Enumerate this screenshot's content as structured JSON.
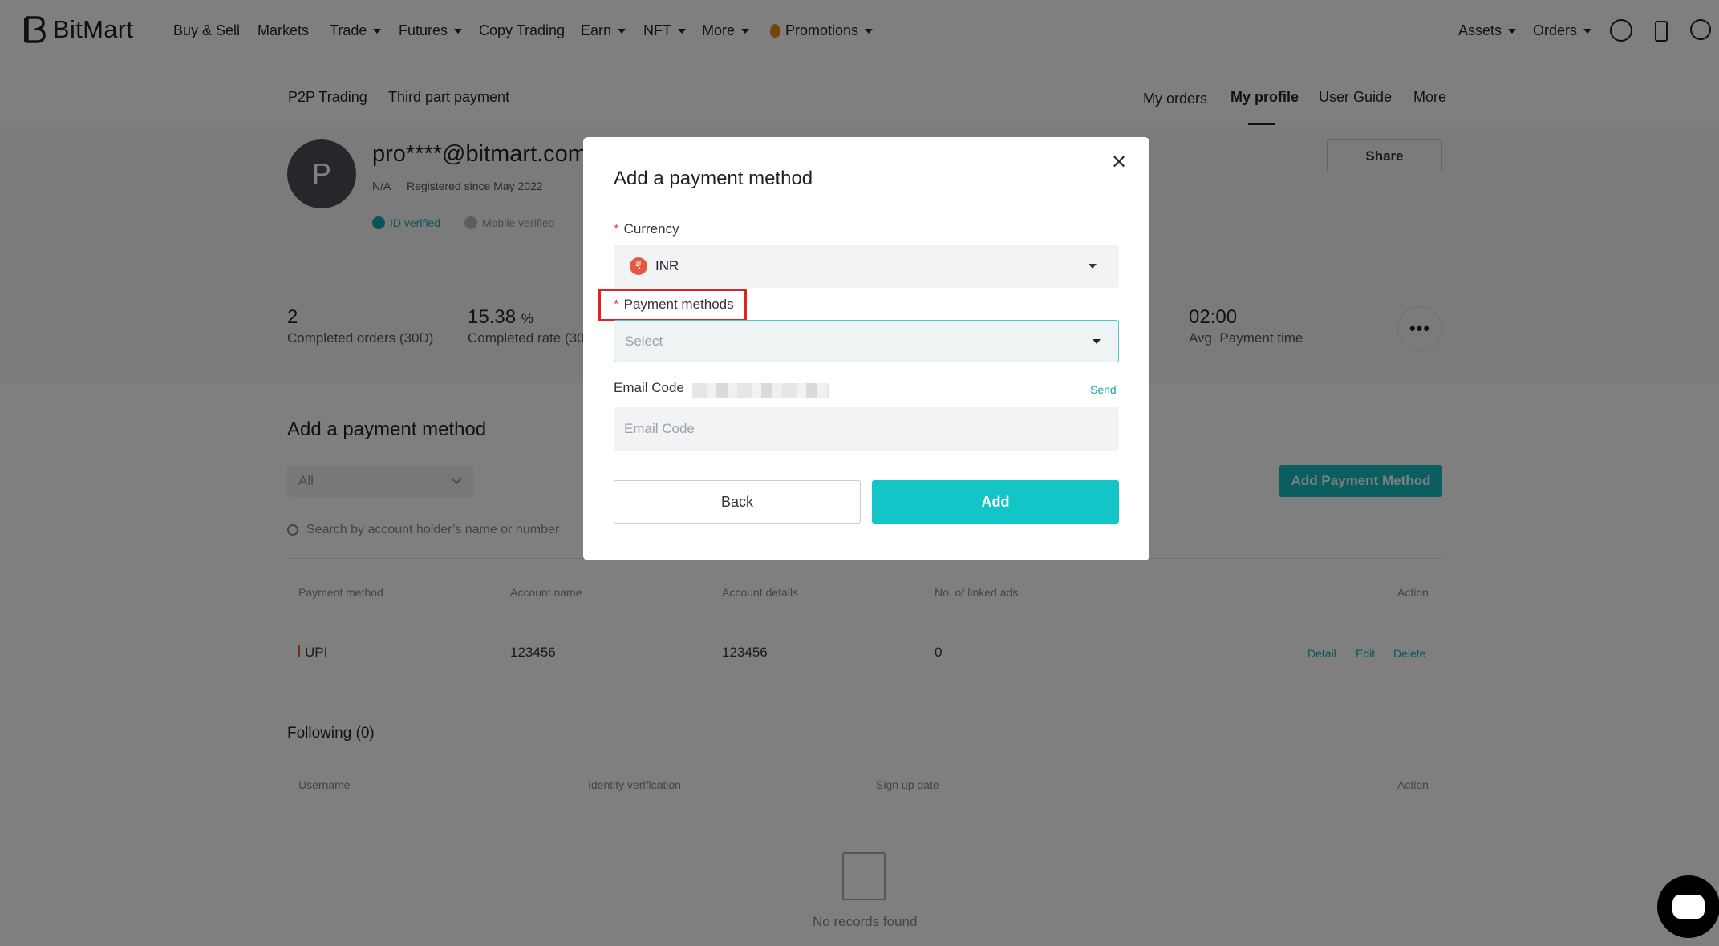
{
  "nav": {
    "brand": "BitMart",
    "items": [
      "Buy & Sell",
      "Markets",
      "Trade",
      "Futures",
      "Copy Trading",
      "Earn",
      "NFT",
      "More",
      "Promotions"
    ],
    "right": [
      "Assets",
      "Orders"
    ]
  },
  "subnav": {
    "left": [
      "P2P Trading",
      "Third part payment"
    ],
    "right": [
      "My orders",
      "My profile",
      "User Guide",
      "More"
    ],
    "active": "My profile"
  },
  "profile": {
    "avatar_letter": "P",
    "email": "pro****@bitmart.com",
    "name": "N/A",
    "registered": "Registered since May 2022",
    "badges": [
      "ID verified",
      "Mobile verified"
    ],
    "share_label": "Share"
  },
  "stats": [
    {
      "value": "2",
      "unit": "",
      "label": "Completed orders (30D)"
    },
    {
      "value": "15.38",
      "unit": "%",
      "label": "Completed rate (30D)"
    },
    {
      "value": "02:00",
      "unit": "",
      "label": "Avg. Payment time"
    }
  ],
  "payment_section": {
    "title": "Add a payment method",
    "filter_value": "All",
    "add_button": "Add Payment Method",
    "search_placeholder": "Search by account holder’s name or number",
    "columns": [
      "Payment method",
      "Account name",
      "Account details",
      "No. of linked ads",
      "Action"
    ],
    "rows": [
      {
        "method": "UPI",
        "account_name": "123456",
        "account_details": "123456",
        "linked_ads": "0"
      }
    ],
    "actions": [
      "Detail",
      "Edit",
      "Delete"
    ]
  },
  "following": {
    "title": "Following (0)",
    "columns": [
      "Username",
      "Identity verification",
      "Sign up date",
      "Action"
    ],
    "empty": "No records found"
  },
  "modal": {
    "title": "Add a payment method",
    "currency_label": "Currency",
    "currency_value": "INR",
    "currency_symbol": "₹",
    "payment_methods_label": "Payment methods",
    "payment_methods_placeholder": "Select",
    "email_code_label": "Email Code",
    "send_label": "Send",
    "email_code_placeholder": "Email Code",
    "back_label": "Back",
    "add_label": "Add"
  },
  "colors": {
    "accent": "#14c5c8",
    "highlight": "#e0231f"
  }
}
